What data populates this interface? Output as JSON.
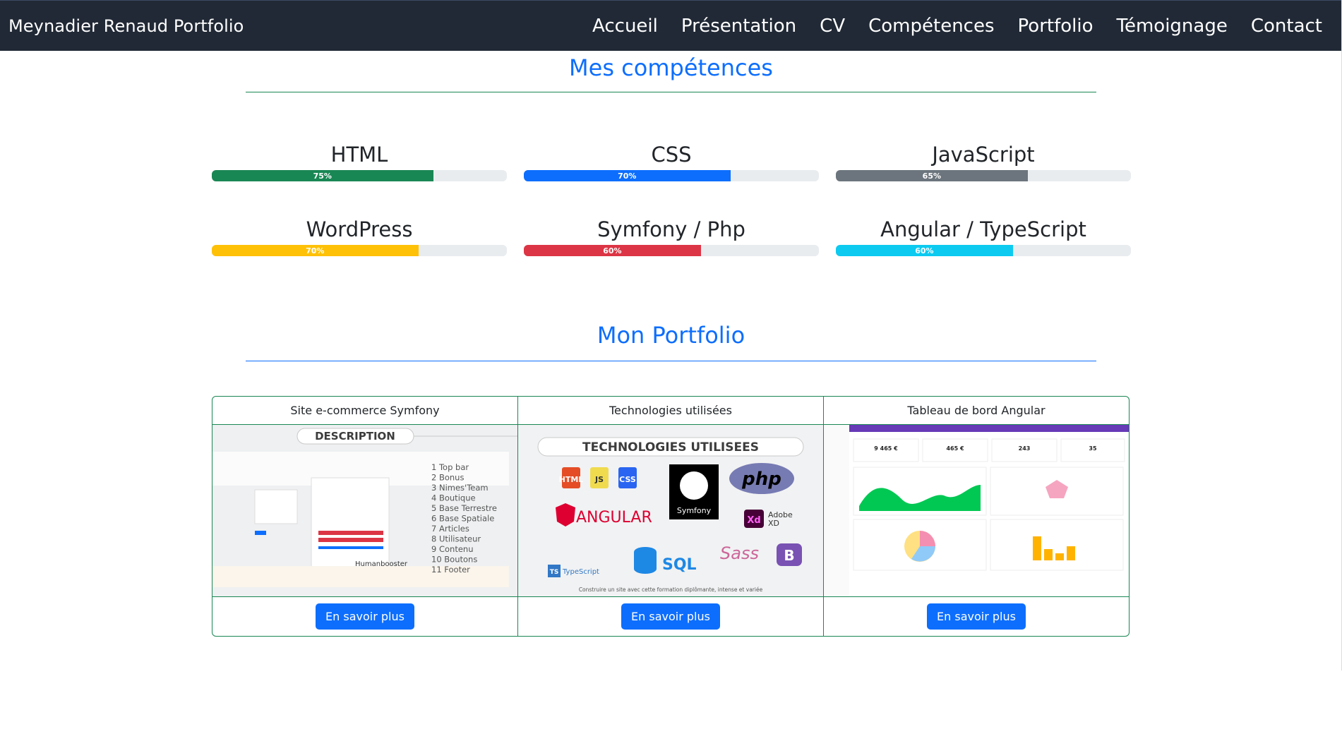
{
  "navbar": {
    "brand": "Meynadier Renaud Portfolio",
    "links": [
      "Accueil",
      "Présentation",
      "CV",
      "Compétences",
      "Portfolio",
      "Témoignage",
      "Contact"
    ]
  },
  "skills_section": {
    "title": "Mes compétences",
    "skills": [
      {
        "name": "HTML",
        "percent": 75,
        "label": "75%",
        "color": "#198754"
      },
      {
        "name": "CSS",
        "percent": 70,
        "label": "70%",
        "color": "#0d6efd"
      },
      {
        "name": "JavaScript",
        "percent": 65,
        "label": "65%",
        "color": "#6c757d"
      },
      {
        "name": "WordPress",
        "percent": 70,
        "label": "70%",
        "color": "#ffc107"
      },
      {
        "name": "Symfony / Php",
        "percent": 60,
        "label": "60%",
        "color": "#dc3545"
      },
      {
        "name": "Angular / TypeScript",
        "percent": 60,
        "label": "60%",
        "color": "#0dcaf0"
      }
    ]
  },
  "portfolio_section": {
    "title": "Mon Portfolio",
    "cards": [
      {
        "header": "Site e-commerce Symfony",
        "button": "En savoir plus",
        "image": {
          "heading": "DESCRIPTION",
          "list": [
            "1 Top bar",
            "2 Bonus",
            "3 Nimes'Team",
            "4 Boutique",
            "5 Base Terrestre",
            "6 Base Spatiale",
            "7 Articles",
            "8 Utilisateur",
            "9 Contenu",
            "10 Boutons",
            "11 Footer"
          ],
          "logo_text": "Humanbooster"
        }
      },
      {
        "header": "Technologies utilisées",
        "button": "En savoir plus",
        "image": {
          "heading": "TECHNOLOGIES UTILISEES",
          "html": "HTML",
          "js": "JS",
          "css": "CSS",
          "symfony": "Symfony",
          "php": "php",
          "angular": "ANGULAR",
          "xd": "Xd",
          "adobe": "Adobe",
          "adobe_xd": "XD",
          "sql": "SQL",
          "sass": "Sass",
          "bootstrap": "B",
          "ts": "TS",
          "typescript": "TypeScript",
          "caption": "Construire un site avec cette formation diplômante, intense et variée"
        }
      },
      {
        "header": "Tableau de bord Angular",
        "button": "En savoir plus",
        "image": {
          "stats": [
            "9 465 €",
            "465 €",
            "243",
            "35"
          ]
        }
      }
    ]
  }
}
